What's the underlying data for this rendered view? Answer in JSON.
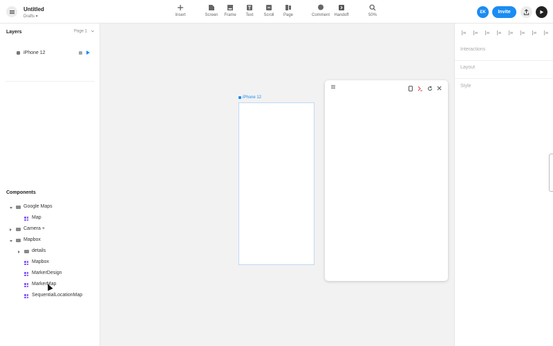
{
  "header": {
    "title": "Untitled",
    "subtitle": "Drafts ▾",
    "tools": [
      {
        "label": "Insert",
        "icon": "plus-icon"
      },
      {
        "label": "Screen",
        "icon": "screen-icon"
      },
      {
        "label": "Frame",
        "icon": "frame-icon"
      },
      {
        "label": "Text",
        "icon": "text-icon"
      },
      {
        "label": "Scroll",
        "icon": "scroll-icon"
      },
      {
        "label": "Page",
        "icon": "page-icon"
      },
      {
        "label": "Comment",
        "icon": "comment-icon"
      },
      {
        "label": "Handoff",
        "icon": "handoff-icon"
      },
      {
        "label": "50%",
        "icon": "zoom-icon"
      }
    ],
    "avatar": "EK",
    "invite_label": "Invite"
  },
  "layers": {
    "title": "Layers",
    "page_selector": "Page 1",
    "items": [
      {
        "label": "iPhone 12"
      }
    ]
  },
  "components": {
    "title": "Components",
    "items": [
      {
        "label": "Google Maps",
        "type": "folder",
        "expanded": true
      },
      {
        "label": "Map",
        "type": "component"
      },
      {
        "label": "Camera +",
        "type": "folder",
        "expanded": false
      },
      {
        "label": "Mapbox",
        "type": "folder",
        "expanded": true
      },
      {
        "label": "details",
        "type": "folder",
        "expanded": false
      },
      {
        "label": "Mapbox",
        "type": "component"
      },
      {
        "label": "MarkerDesign",
        "type": "component"
      },
      {
        "label": "MarkerMap",
        "type": "component"
      },
      {
        "label": "SequentialLocationMap",
        "type": "component"
      }
    ]
  },
  "canvas": {
    "frame_label": "iPhone 12"
  },
  "right_panel": {
    "sections": [
      "Interactions",
      "Layout",
      "Style"
    ]
  },
  "colors": {
    "accent": "#1b8cf2",
    "component": "#8a5cf6"
  }
}
